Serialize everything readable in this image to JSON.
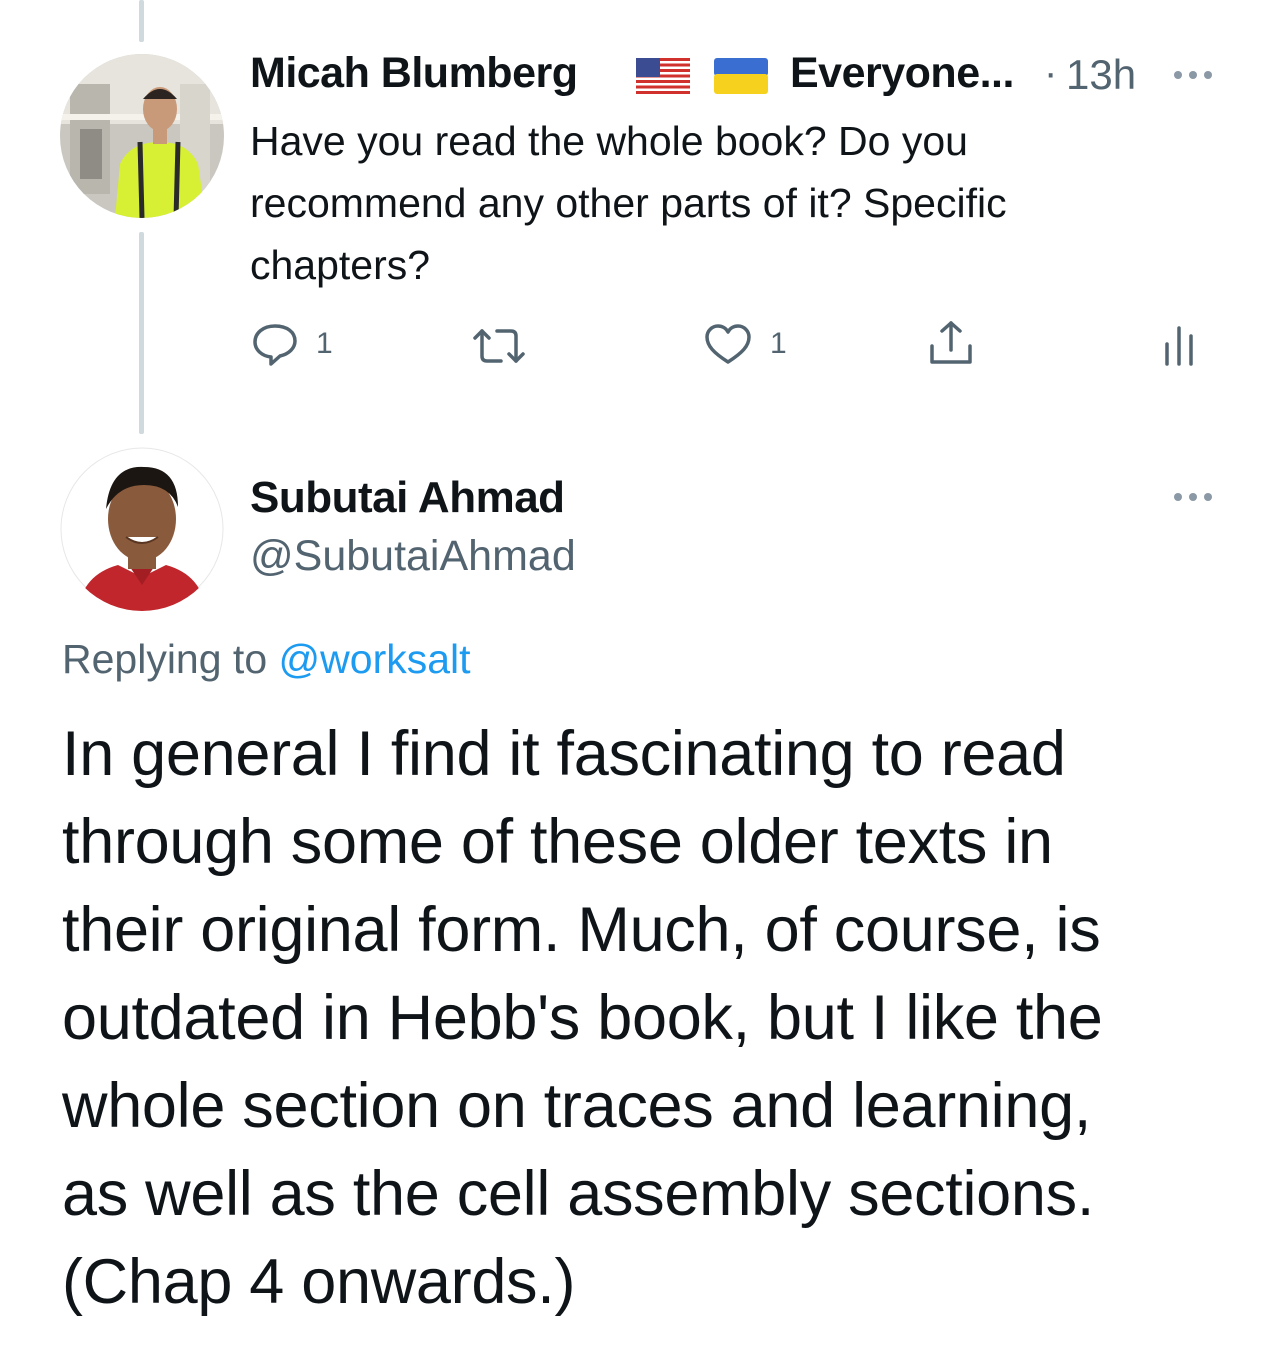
{
  "reply_tweet": {
    "author_name": "Micah Blumberg",
    "author_name_suffix": "Everyone...",
    "separator": "·",
    "timestamp": "13h",
    "text_lines": [
      "Have you read the whole book? Do you",
      "recommend any other parts of it? Specific",
      "chapters?"
    ],
    "reply_count": "1",
    "like_count": "1",
    "avatar": "person-with-backpack-avatar",
    "flags": [
      "us-flag-icon",
      "ukraine-flag-icon"
    ]
  },
  "main_tweet": {
    "author_name": "Subutai Ahmad",
    "author_handle": "@SubutaiAhmad",
    "replying_prefix": "Replying to",
    "replying_handle": "@worksalt",
    "text_lines": [
      "In general I find it fascinating to read",
      "through some of these older texts in",
      "their original form. Much, of course, is",
      "outdated in Hebb's book, but I like the",
      "whole section on traces and learning,",
      "as well as the cell assembly sections.",
      "(Chap 4 onwards.)"
    ]
  },
  "icons": {
    "reply": "reply-icon",
    "retweet": "retweet-icon",
    "like": "heart-icon",
    "share": "share-icon",
    "analytics": "analytics-icon",
    "more": "more-icon"
  },
  "colors": {
    "text": "#0f1419",
    "muted": "#536471",
    "link": "#1d9bf0",
    "thread_line": "#cfd9de"
  }
}
